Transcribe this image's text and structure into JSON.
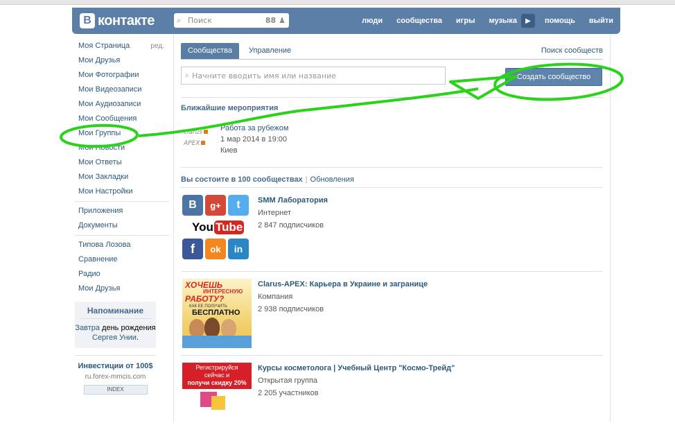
{
  "header": {
    "logo_letter": "В",
    "logo_text": "контакте",
    "search_placeholder": "Поиск",
    "search_count": "88",
    "nav": [
      "люди",
      "сообщества",
      "игры",
      "музыка",
      "помощь",
      "выйти"
    ]
  },
  "sidebar": {
    "items": [
      {
        "label": "Моя Страница",
        "edit": "ред."
      },
      {
        "label": "Мои Друзья"
      },
      {
        "label": "Мои Фотографии"
      },
      {
        "label": "Мои Видеозаписи"
      },
      {
        "label": "Мои Аудиозаписи"
      },
      {
        "label": "Мои Сообщения"
      },
      {
        "label": "Мои Группы"
      },
      {
        "label": "Мои Новости"
      },
      {
        "label": "Мои Ответы"
      },
      {
        "label": "Мои Закладки"
      },
      {
        "label": "Мои Настройки"
      }
    ],
    "apps": [
      {
        "label": "Приложения"
      },
      {
        "label": "Документы"
      }
    ],
    "extra": [
      {
        "label": "Типова Лозова"
      },
      {
        "label": "Сравнение"
      },
      {
        "label": "Радио"
      },
      {
        "label": "Мои Друзья"
      }
    ],
    "reminder": {
      "title": "Напоминание",
      "word_tomorrow": "Завтра",
      "text_mid": "день рождения",
      "person_link": "Сергея Унии",
      "dot": "."
    },
    "ad": {
      "title": "Инвестиции от 100$",
      "url": "ru.forex-mmcis.com",
      "img_text": "INDEX"
    }
  },
  "main": {
    "tabs": {
      "active": "Сообщества",
      "second": "Управление",
      "right": "Поиск сообществ"
    },
    "search_placeholder": "Начните вводить имя или название",
    "create_button": "Создать сообщество",
    "events_title": "Ближайшие мероприятия",
    "event": {
      "logo_line1": "clarus",
      "logo_line2": "APEX",
      "name": "Работа за рубежом",
      "date": "1 мар 2014 в 19:00",
      "city": "Киев"
    },
    "membership_title": "Вы состоите в 100 сообществах",
    "updates_link": "Обновления",
    "groups": [
      {
        "name": "SMM Лаборатория",
        "type": "Интернет",
        "subs": "2 847 подписчиков"
      },
      {
        "name": "Clarus-APEX: Карьера в Украине и загранице",
        "type": "Компания",
        "subs": "2 938 подписчиков"
      },
      {
        "name": "Курсы косметолога | Учебный Центр \"Космо-Трейд\"",
        "type": "Открытая группа",
        "subs": "2 205 участников"
      }
    ],
    "thumb_smm": {
      "vk": "В",
      "gplus": "g+",
      "tw": "t",
      "youtube_you": "You",
      "youtube_tube": "Tube",
      "fb": "f",
      "ok": "ok",
      "in": "in"
    },
    "thumb_clarus": {
      "line1": "ХОЧЕШЬ",
      "line2": "ИНТЕРЕСНУЮ",
      "line3": "РАБОТУ?",
      "line4": "КАК ЕЕ ПОЛУЧИТЬ",
      "line5": "БЕСПЛАТНО"
    },
    "thumb_kosmo": {
      "line1": "Регистрируйся",
      "line2": "сейчас и",
      "line3": "получи скидку 20%"
    }
  },
  "colors": {
    "header": "#5b7fa6",
    "link": "#2b587a",
    "annotation": "#2ad31a"
  }
}
